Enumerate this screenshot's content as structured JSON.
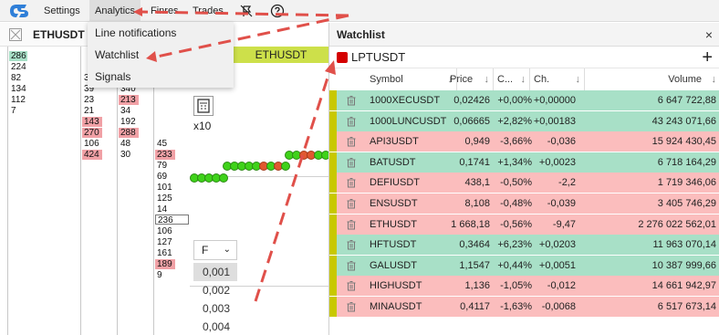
{
  "menubar": {
    "items": [
      "Settings",
      "Analytics",
      "Finres",
      "Trades"
    ]
  },
  "dropdown": {
    "items": [
      "Line notifications",
      "Watchlist",
      "Signals"
    ]
  },
  "ladder": {
    "symbol": "ETHUSDT",
    "col1": [
      "286",
      "224",
      "82",
      "134",
      "112",
      "7"
    ],
    "col2": [
      "3",
      "39",
      "23",
      "21",
      "143",
      "270",
      "106",
      "424"
    ],
    "col3": [
      "340",
      "213",
      "34",
      "192",
      "288",
      "48",
      "30"
    ],
    "col4": [
      "45",
      "233",
      "79",
      "69",
      "101",
      "125",
      "14",
      "236",
      "106",
      "127",
      "161",
      "189",
      "9"
    ]
  },
  "mid": {
    "symbol": "ETHUSDT",
    "zoom": "x10",
    "select_value": "F",
    "ticks": [
      "0,001",
      "0,002",
      "0,003",
      "0,004"
    ]
  },
  "watchlist": {
    "title": "Watchlist",
    "close": "×",
    "current_symbol": "LPTUSDT",
    "add": "+",
    "columns": [
      "Symbol",
      "Price",
      "C...",
      "Ch.",
      "Volume"
    ],
    "rows": [
      {
        "symbol": "1000XECUSDT",
        "price": "0,02426",
        "change_pct": "+0,00%",
        "change": "+0,00000",
        "volume": "6 647 722,88",
        "dir": "up"
      },
      {
        "symbol": "1000LUNCUSDT",
        "price": "0,06665",
        "change_pct": "+2,82%",
        "change": "+0,00183",
        "volume": "43 243 071,66",
        "dir": "up"
      },
      {
        "symbol": "API3USDT",
        "price": "0,949",
        "change_pct": "-3,66%",
        "change": "-0,036",
        "volume": "15 924 430,45",
        "dir": "down"
      },
      {
        "symbol": "BATUSDT",
        "price": "0,1741",
        "change_pct": "+1,34%",
        "change": "+0,0023",
        "volume": "6 718 164,29",
        "dir": "up"
      },
      {
        "symbol": "DEFIUSDT",
        "price": "438,1",
        "change_pct": "-0,50%",
        "change": "-2,2",
        "volume": "1 719 346,06",
        "dir": "down"
      },
      {
        "symbol": "ENSUSDT",
        "price": "8,108",
        "change_pct": "-0,48%",
        "change": "-0,039",
        "volume": "3 405 746,29",
        "dir": "down"
      },
      {
        "symbol": "ETHUSDT",
        "price": "1 668,18",
        "change_pct": "-0,56%",
        "change": "-9,47",
        "volume": "2 276 022 562,01",
        "dir": "down"
      },
      {
        "symbol": "HFTUSDT",
        "price": "0,3464",
        "change_pct": "+6,23%",
        "change": "+0,0203",
        "volume": "11 963 070,14",
        "dir": "up"
      },
      {
        "symbol": "GALUSDT",
        "price": "1,1547",
        "change_pct": "+0,44%",
        "change": "+0,0051",
        "volume": "10 387 999,66",
        "dir": "up"
      },
      {
        "symbol": "HIGHUSDT",
        "price": "1,136",
        "change_pct": "-1,05%",
        "change": "-0,012",
        "volume": "14 661 942,97",
        "dir": "down"
      },
      {
        "symbol": "MINAUSDT",
        "price": "0,4117",
        "change_pct": "-1,63%",
        "change": "-0,0068",
        "volume": "6 517 673,14",
        "dir": "down"
      }
    ]
  },
  "colors": {
    "up_row": "#a8e0c7",
    "down_row": "#fbbdbd",
    "accent_strip": "#c8c800",
    "annotation": "#e0504a"
  }
}
